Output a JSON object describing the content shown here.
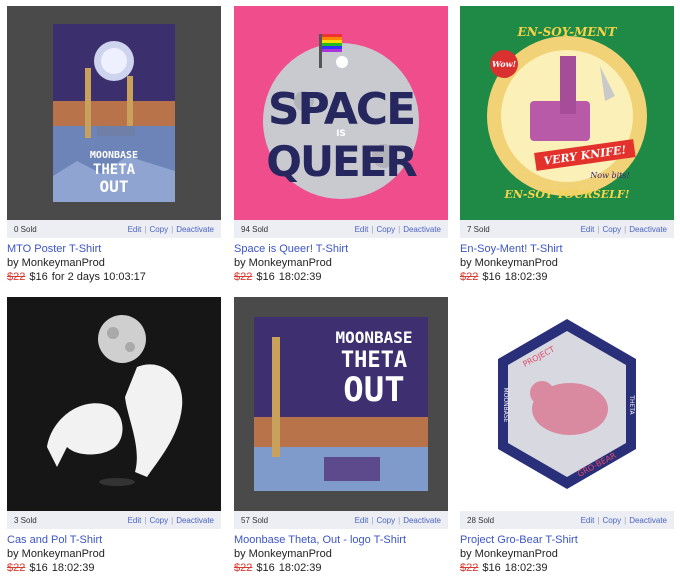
{
  "actions": {
    "edit": "Edit",
    "copy": "Copy",
    "deactivate": "Deactivate"
  },
  "products": [
    {
      "sold": "0 Sold",
      "title": "MTO Poster T-Shirt",
      "by": "by MonkeymanProd",
      "old_price": "$22",
      "price": "$16",
      "timer": "for 2 days 10:03:17",
      "art": {
        "line1": "MOONBASE",
        "line2": "THETA",
        "line3": "OUT"
      }
    },
    {
      "sold": "94 Sold",
      "title": "Space is Queer! T-Shirt",
      "by": "by MonkeymanProd",
      "old_price": "$22",
      "price": "$16",
      "timer": "18:02:39",
      "art": {
        "word1": "SPACE",
        "word2": "IS",
        "word3": "QUEER"
      }
    },
    {
      "sold": "7 Sold",
      "title": "En-Soy-Ment! T-Shirt",
      "by": "by MonkeymanProd",
      "old_price": "$22",
      "price": "$16",
      "timer": "18:02:39",
      "art": {
        "top": "EN-SOY-MENT",
        "badge": "Wow!",
        "banner": "VERY KNIFE!",
        "tag": "Now bits!",
        "bottom": "EN-SOY YOURSELF!"
      }
    },
    {
      "sold": "3 Sold",
      "title": "Cas and Pol T-Shirt",
      "by": "by MonkeymanProd",
      "old_price": "$22",
      "price": "$16",
      "timer": "18:02:39"
    },
    {
      "sold": "57 Sold",
      "title": "Moonbase Theta, Out - logo T-Shirt",
      "by": "by MonkeymanProd",
      "old_price": "$22",
      "price": "$16",
      "timer": "18:02:39",
      "art": {
        "line1": "MOONBASE",
        "line2": "THETA",
        "line3": "OUT"
      }
    },
    {
      "sold": "28 Sold",
      "title": "Project Gro-Bear T-Shirt",
      "by": "by MonkeymanProd",
      "old_price": "$22",
      "price": "$16",
      "timer": "18:02:39",
      "art": {
        "top": "PROJECT",
        "bottom": "GRO-BEAR",
        "left": "MOONBASE",
        "right": "THETA"
      }
    }
  ]
}
